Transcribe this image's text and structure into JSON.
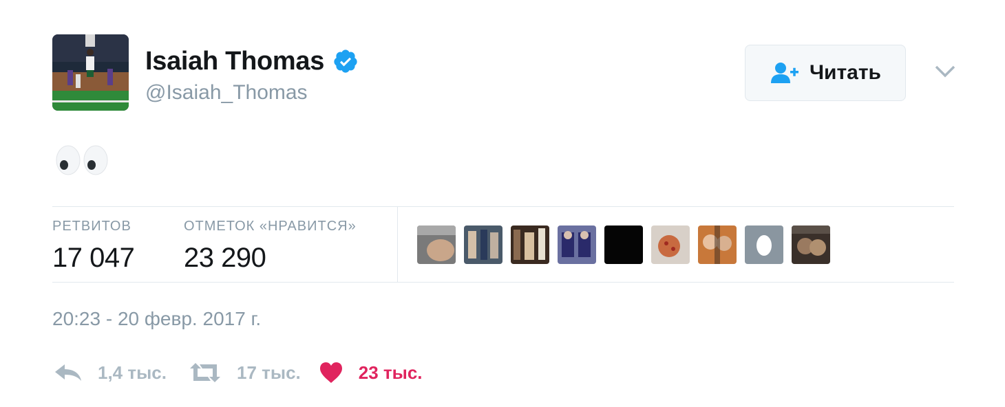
{
  "user": {
    "fullname": "Isaiah Thomas",
    "username": "@Isaiah_Thomas",
    "avatar_icon": "avatar-photo"
  },
  "follow_button": {
    "label": "Читать",
    "icon": "follow-user-icon"
  },
  "tweet": {
    "text_emoji": "eyes-emoji"
  },
  "stats": {
    "retweets_label": "РЕТВИТОВ",
    "retweets_value": "17 047",
    "likes_label": "ОТМЕТОК «НРАВИТСЯ»",
    "likes_value": "23 290"
  },
  "likers": [
    {
      "icon": "liker-avatar-1"
    },
    {
      "icon": "liker-avatar-2"
    },
    {
      "icon": "liker-avatar-3"
    },
    {
      "icon": "liker-avatar-4"
    },
    {
      "icon": "liker-avatar-5"
    },
    {
      "icon": "liker-avatar-6"
    },
    {
      "icon": "liker-avatar-7"
    },
    {
      "icon": "liker-avatar-8-egg"
    },
    {
      "icon": "liker-avatar-9"
    }
  ],
  "timestamp": "20:23 - 20 февр. 2017 г.",
  "actions": {
    "reply_count": "1,4 тыс.",
    "retweet_count": "17 тыс.",
    "like_count": "23 тыс."
  },
  "colors": {
    "verified": "#1da1f2",
    "follow_icon": "#1da1f2",
    "like": "#e0245e",
    "muted": "#8899a6",
    "action_icon": "#aab8c2"
  }
}
